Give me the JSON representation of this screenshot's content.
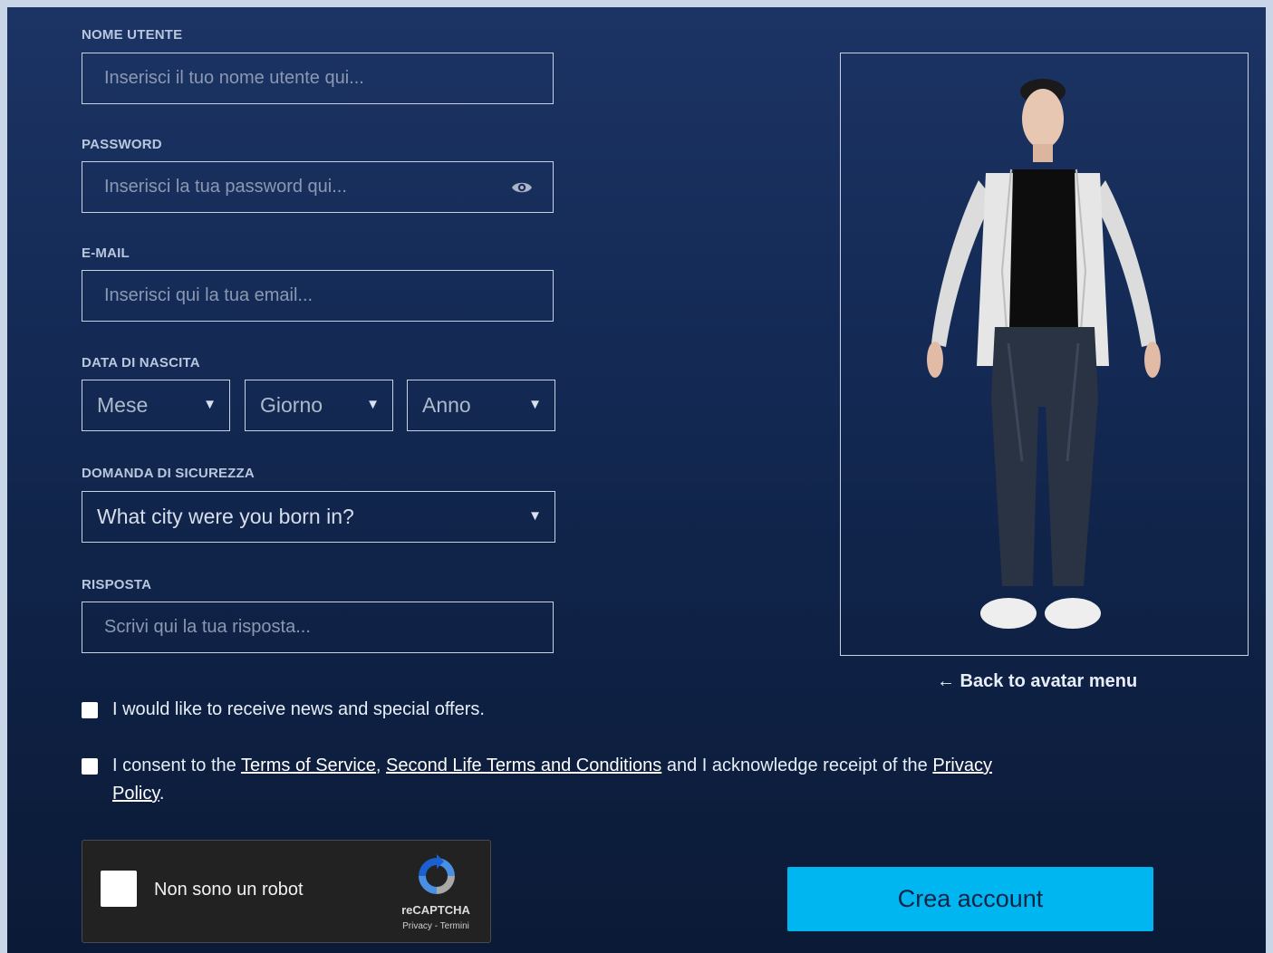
{
  "form": {
    "username": {
      "label": "NOME UTENTE",
      "placeholder": "Inserisci il tuo nome utente qui...",
      "value": ""
    },
    "password": {
      "label": "PASSWORD",
      "placeholder": "Inserisci la tua password qui...",
      "value": "",
      "toggle_icon": "eye-icon"
    },
    "email": {
      "label": "E-MAIL",
      "placeholder": "Inserisci qui la tua email...",
      "value": ""
    },
    "birthdate": {
      "label": "DATA DI NASCITA",
      "month": "Mese",
      "day": "Giorno",
      "year": "Anno"
    },
    "security_question": {
      "label": "DOMANDA DI SICUREZZA",
      "selected": "What city were you born in?"
    },
    "answer": {
      "label": "RISPOSTA",
      "placeholder": "Scrivi qui la tua risposta...",
      "value": ""
    },
    "news_checkbox": {
      "label": "I would like to receive news and special offers.",
      "checked": false
    },
    "consent_checkbox": {
      "checked": false,
      "text_before": "I consent to the ",
      "tos_link": "Terms of Service",
      "comma": ", ",
      "sl_terms_link": "Second Life Terms and Conditions",
      "text_middle": " and I acknowledge receipt of the ",
      "privacy_link": "Privacy Policy",
      "period": "."
    }
  },
  "avatar": {
    "back_link": "← Back to avatar menu"
  },
  "recaptcha": {
    "label": "Non sono un robot",
    "brand": "reCAPTCHA",
    "links": "Privacy - Termini"
  },
  "submit": {
    "label": "Crea account",
    "color": "#00b6f0"
  },
  "colors": {
    "background_top": "#1c3464",
    "background_bottom": "#0b1a36",
    "field_border": "#c8d2e2",
    "label_text": "#b9c7de"
  }
}
